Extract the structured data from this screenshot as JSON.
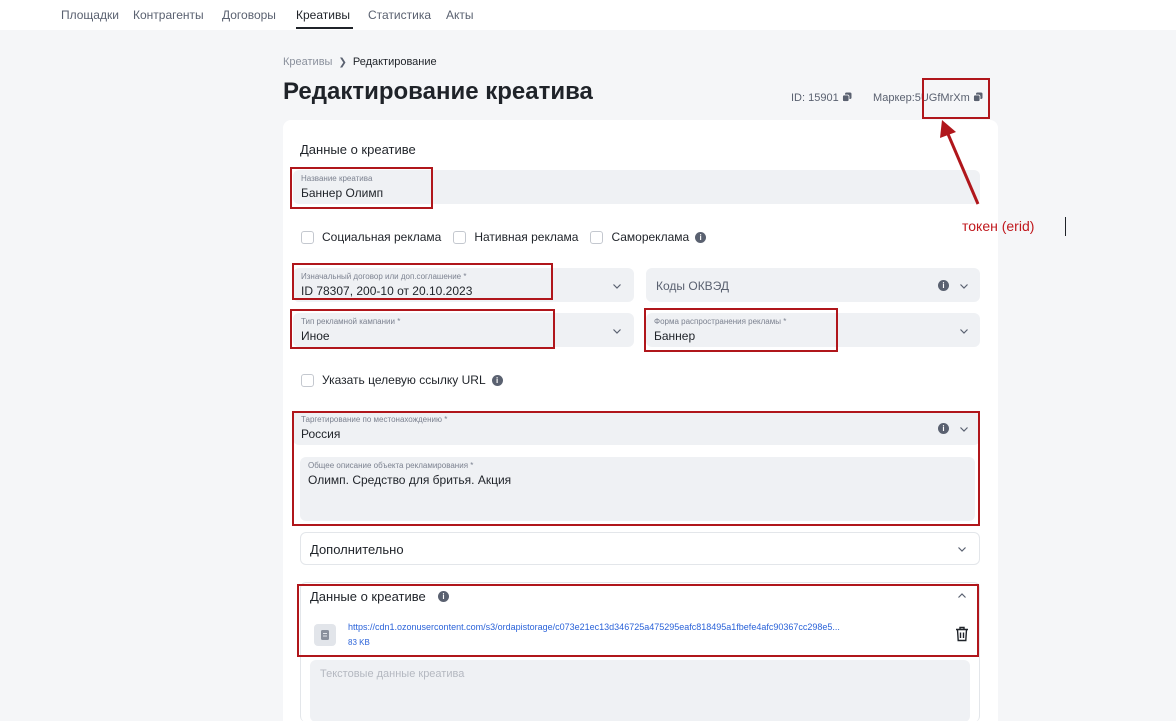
{
  "nav": {
    "items": [
      "Площадки",
      "Контрагенты",
      "Договоры",
      "Креативы",
      "Статистика",
      "Акты"
    ],
    "active": "Креативы"
  },
  "breadcrumb": {
    "parent": "Креативы",
    "current": "Редактирование"
  },
  "page": {
    "title": "Редактирование креатива",
    "id_label": "ID: 15901",
    "marker_label": "Маркер:",
    "marker_value": "5UGfMrXm"
  },
  "form": {
    "section_title": "Данные о креативе",
    "name": {
      "label": "Название креатива",
      "value": "Баннер Олимп"
    },
    "checkboxes": {
      "social": "Социальная реклама",
      "native": "Нативная реклама",
      "self": "Самореклама"
    },
    "contract": {
      "label": "Изначальный договор или доп.соглашение *",
      "value": "ID 78307, 200-10 от 20.10.2023"
    },
    "okved": {
      "placeholder": "Коды ОКВЭД"
    },
    "campaign_type": {
      "label": "Тип рекламной кампании *",
      "value": "Иное"
    },
    "ad_form": {
      "label": "Форма распространения рекламы *",
      "value": "Баннер"
    },
    "target_url_checkbox": "Указать целевую ссылку URL",
    "geo": {
      "label": "Таргетирование по местонахождению *",
      "value": "Россия"
    },
    "description": {
      "label": "Общее описание объекта рекламирования *",
      "value": "Олимп. Средство для бритья. Акция"
    },
    "additional_title": "Дополнительно",
    "creative_data_title": "Данные о креативе",
    "file": {
      "url": "https://cdn1.ozonusercontent.com/s3/ordapistorage/c073e21ec13d346725a475295eafc818495a1fbefe4afc90367cc298e5...",
      "size": "83 KB"
    },
    "text_data": {
      "placeholder": "Текстовые данные креатива"
    }
  },
  "annotation": {
    "text": "токен (erid)",
    "color": "#c0181d"
  },
  "colors": {
    "accent_link": "#2b63d9",
    "annotation_box": "#b0161b",
    "field_bg": "#eff1f4"
  }
}
